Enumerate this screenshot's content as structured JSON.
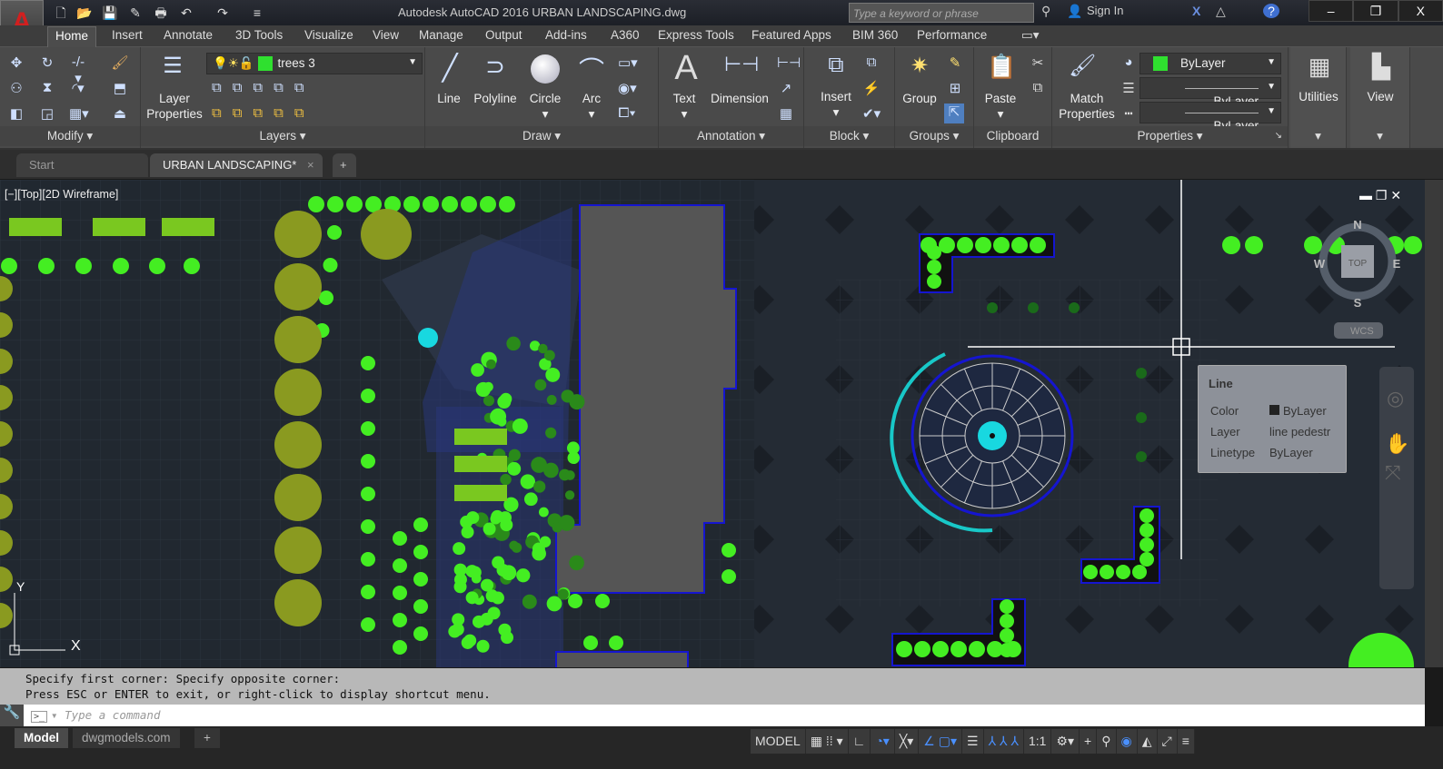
{
  "app": {
    "title": "Autodesk AutoCAD 2016    URBAN LANDSCAPING.dwg",
    "logo": "A"
  },
  "titlebar": {
    "search_placeholder": "Type a keyword or phrase",
    "sign_in": "Sign In",
    "minimize": "‒",
    "restore": "❐",
    "close": "X"
  },
  "ribbon_tabs": [
    "Home",
    "Insert",
    "Annotate",
    "3D Tools",
    "Visualize",
    "View",
    "Manage",
    "Output",
    "Add-ins",
    "A360",
    "Express Tools",
    "Featured Apps",
    "BIM 360",
    "Performance"
  ],
  "panels": {
    "modify": {
      "label": "Modify"
    },
    "layers": {
      "label": "Layers",
      "button": "Layer\nProperties",
      "current_layer": "trees 3",
      "layer_color": "#2fe02f"
    },
    "draw": {
      "label": "Draw",
      "line": "Line",
      "polyline": "Polyline",
      "circle": "Circle",
      "arc": "Arc"
    },
    "annotation": {
      "label": "Annotation",
      "text": "Text",
      "dimension": "Dimension"
    },
    "block": {
      "label": "Block",
      "insert": "Insert"
    },
    "groups": {
      "label": "Groups",
      "group": "Group"
    },
    "clipboard": {
      "label": "Clipboard",
      "paste": "Paste"
    },
    "properties": {
      "label": "Properties",
      "match": "Match\nProperties",
      "color": "ByLayer",
      "lineweight": "ByLayer",
      "linetype": "ByLayer"
    },
    "utilities": {
      "label": "Utilities"
    },
    "view": {
      "label": "View"
    }
  },
  "file_tabs": {
    "start": "Start",
    "active": "URBAN LANDSCAPING*",
    "close": "×",
    "new": "+"
  },
  "viewport": {
    "label": "[−][Top][2D Wireframe]",
    "viewcube": {
      "top": "TOP",
      "n": "N",
      "s": "S",
      "e": "E",
      "w": "W",
      "ucs": "WCS"
    },
    "ucs_y": "Y",
    "ucs_x": "X"
  },
  "tooltip": {
    "title": "Line",
    "rows": [
      {
        "k": "Color",
        "v": "ByLayer"
      },
      {
        "k": "Layer",
        "v": "line pedestr"
      },
      {
        "k": "Linetype",
        "v": "ByLayer"
      }
    ]
  },
  "command": {
    "history": [
      "Specify first corner: Specify opposite corner:",
      "Press ESC or ENTER to exit, or right-click to display shortcut menu."
    ],
    "placeholder": "Type a command"
  },
  "layout_tabs": [
    "Model",
    "dwgmodels.com"
  ],
  "status": {
    "model": "MODEL",
    "scale": "1:1"
  }
}
